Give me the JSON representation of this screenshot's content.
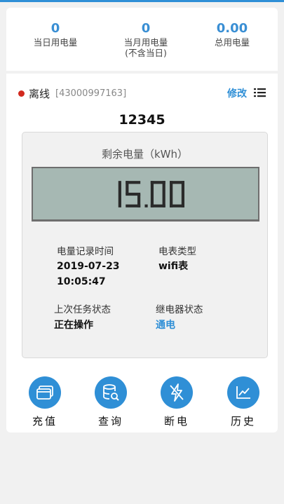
{
  "stats": [
    {
      "value": "0",
      "label": "当日用电量",
      "label2": ""
    },
    {
      "value": "0",
      "label": "当月用电量",
      "label2": "(不含当日)"
    },
    {
      "value": "0.00",
      "label": "总用电量",
      "label2": ""
    }
  ],
  "device": {
    "status": "离线",
    "status_color": "#d22a1f",
    "id": "[43000997163]",
    "edit_label": "修改",
    "name": "12345"
  },
  "meter": {
    "title": "剩余电量（kWh）",
    "reading": "15.00",
    "record_time_label": "电量记录时间",
    "record_date": "2019-07-23",
    "record_clock": "10:05:47",
    "meter_type_label": "电表类型",
    "meter_type": "wifi表",
    "last_task_label": "上次任务状态",
    "last_task": "正在操作",
    "relay_label": "继电器状态",
    "relay": "通电"
  },
  "actions": [
    {
      "label": "充值",
      "icon": "card-icon"
    },
    {
      "label": "查询",
      "icon": "database-search-icon"
    },
    {
      "label": "断电",
      "icon": "lightning-off-icon"
    },
    {
      "label": "历史",
      "icon": "chart-line-icon"
    }
  ],
  "colors": {
    "accent": "#2f8fd6",
    "lcd": "#a6b8b3"
  }
}
